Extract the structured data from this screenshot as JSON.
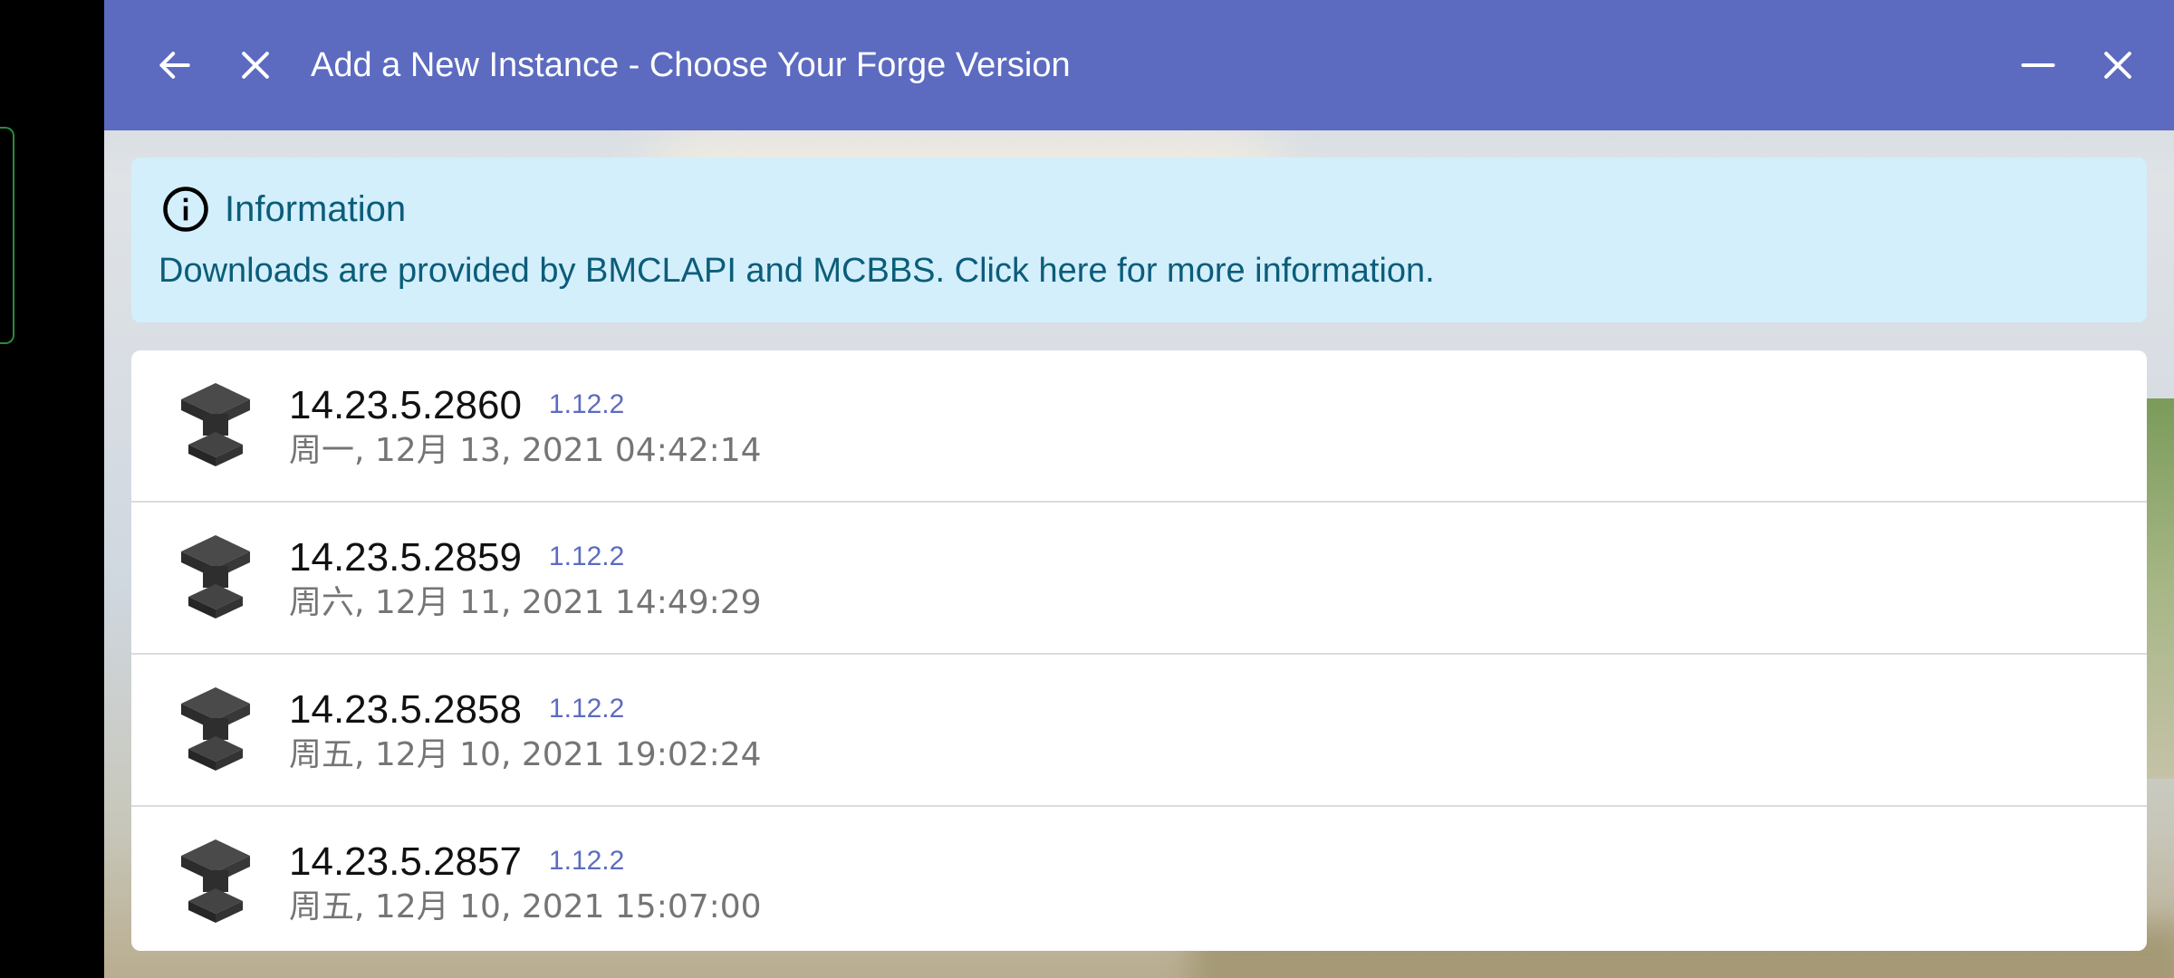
{
  "titlebar": {
    "title": "Add a New Instance - Choose Your Forge Version",
    "back_icon": "arrow-left-icon",
    "close_icon": "close-icon",
    "minimize_icon": "minimize-icon",
    "window_close_icon": "close-icon",
    "color": "#5c6bc0"
  },
  "info": {
    "title": "Information",
    "text": "Downloads are provided by BMCLAPI and MCBBS. Click here for more information.",
    "icon": "info-icon",
    "bg_color": "#d3effb",
    "text_color": "#0b5d7a"
  },
  "versions": [
    {
      "version": "14.23.5.2860",
      "mc": "1.12.2",
      "date": "周一, 12月 13, 2021 04:42:14"
    },
    {
      "version": "14.23.5.2859",
      "mc": "1.12.2",
      "date": "周六, 12月 11, 2021 14:49:29"
    },
    {
      "version": "14.23.5.2858",
      "mc": "1.12.2",
      "date": "周五, 12月 10, 2021 19:02:24"
    },
    {
      "version": "14.23.5.2857",
      "mc": "1.12.2",
      "date": "周五, 12月 10, 2021 15:07:00"
    }
  ],
  "row_icon": "forge-anvil-icon"
}
